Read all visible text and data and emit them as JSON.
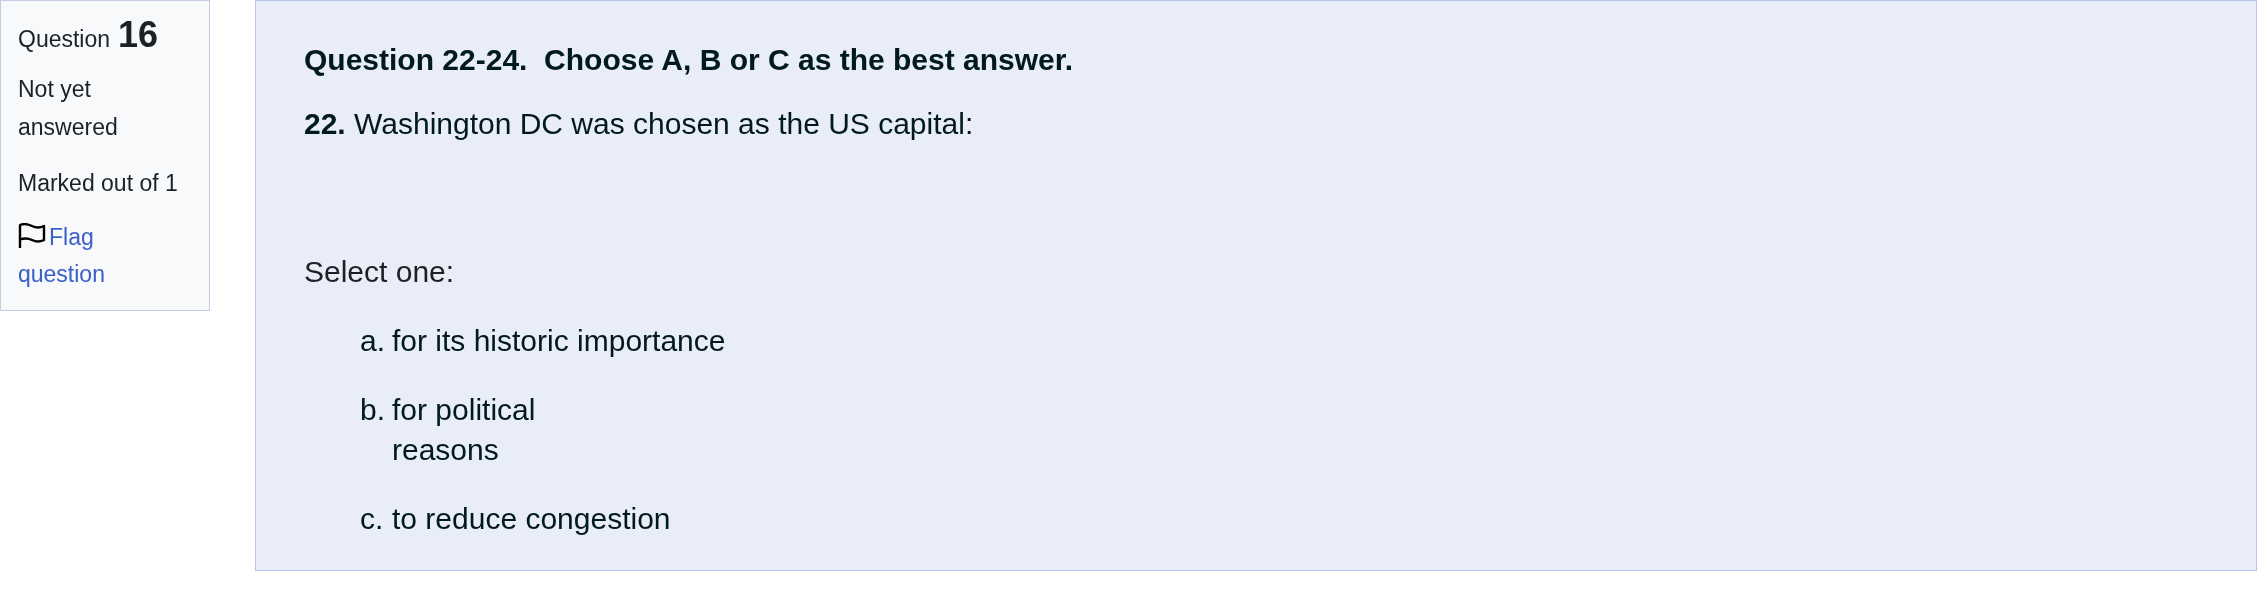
{
  "question_info": {
    "label": "Question",
    "number": "16",
    "state": "Not yet answered",
    "grade": "Marked out of 1",
    "flag_link": "Flag question",
    "flagged": false
  },
  "question": {
    "heading": "Question 22-24.  Choose A, B or C as the best answer.",
    "prompt": "**22.** Washington DC was chosen as the US capital:",
    "select_label": "Select one:",
    "options": [
      {
        "label": "a.",
        "text": "for its historic importance"
      },
      {
        "label": "b.",
        "text": "for political\nreasons"
      },
      {
        "label": "c.",
        "text": "to reduce congestion"
      }
    ]
  }
}
